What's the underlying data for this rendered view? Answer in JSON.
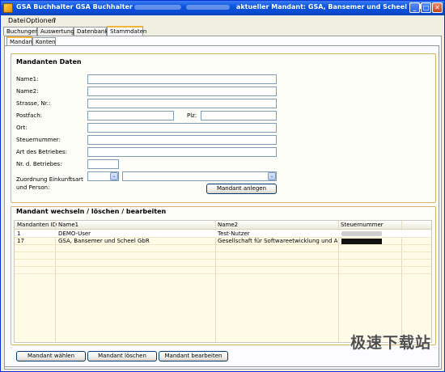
{
  "window": {
    "title_prefix": "GSA Buchhalter GSA Buchhalter",
    "title_mandant": "aktueller Mandant: GSA, Bansemer und Scheel GbR",
    "min": "_",
    "max": "□",
    "close": "✕"
  },
  "menu": [
    {
      "label": "Datei"
    },
    {
      "label": "Optionen"
    },
    {
      "label": "?"
    }
  ],
  "main_tabs": [
    {
      "label": "Buchungen"
    },
    {
      "label": "Auswertung"
    },
    {
      "label": "Datenbank"
    },
    {
      "label": "Stammdaten"
    }
  ],
  "sub_tabs": [
    {
      "label": "Mandant"
    },
    {
      "label": "Konten"
    }
  ],
  "form": {
    "title": "Mandanten Daten",
    "labels": {
      "name1": "Name1:",
      "name2": "Name2:",
      "strasse": "Strasse, Nr.:",
      "postfach": "Postfach:",
      "plz": "Plz:",
      "ort": "Ort:",
      "steuernummer": "Steuernummer:",
      "art": "Art des Betriebes:",
      "nr": "Nr. d. Betriebes:",
      "zuordnung1": "Zuordnung Einkunftsart",
      "zuordnung2": "und Person:"
    },
    "values": {
      "name1": "",
      "name2": "",
      "strasse": "",
      "postfach": "",
      "plz": "",
      "ort": "",
      "steuernummer": "",
      "art": "",
      "nr": ""
    },
    "combo_arrow": "⌄",
    "create_button": "Mandant anlegen"
  },
  "list": {
    "title": "Mandant wechseln / löschen / bearbeiten",
    "columns": [
      "Mandanten ID",
      "Name1",
      "Name2",
      "Steuernummer"
    ],
    "rows": [
      {
        "id": "1",
        "name1": "DEMO-User",
        "name2": "Test-Nutzer"
      },
      {
        "id": "17",
        "name1": "GSA, Bansemer und Scheel GbR",
        "name2": "Gesellschaft für Softwareetwicklung und Analytik"
      }
    ]
  },
  "buttons": {
    "select": "Mandant wählen",
    "delete": "Mandant löschen",
    "edit": "Mandant bearbeiten"
  },
  "watermark": "极速下载站"
}
